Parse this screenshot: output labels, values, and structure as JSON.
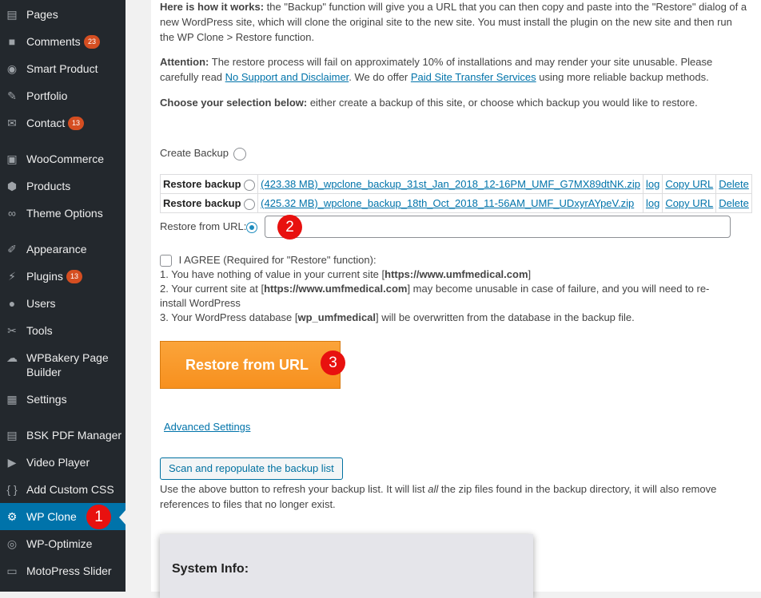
{
  "sidebar": {
    "items": [
      {
        "label": "Pages",
        "icon": "pages-icon",
        "glyph": "▤"
      },
      {
        "label": "Comments",
        "icon": "comments-icon",
        "glyph": "■",
        "count": "23"
      },
      {
        "label": "Smart Product",
        "icon": "eye-icon",
        "glyph": "◉"
      },
      {
        "label": "Portfolio",
        "icon": "pin-icon",
        "glyph": "✎"
      },
      {
        "label": "Contact",
        "icon": "mail-icon",
        "glyph": "✉",
        "count": "13"
      },
      {
        "label": "WooCommerce",
        "icon": "woocommerce-icon",
        "glyph": "▣"
      },
      {
        "label": "Products",
        "icon": "box-icon",
        "glyph": "⬢"
      },
      {
        "label": "Theme Options",
        "icon": "infinity-icon",
        "glyph": "∞"
      },
      {
        "label": "Appearance",
        "icon": "brush-icon",
        "glyph": "✐"
      },
      {
        "label": "Plugins",
        "icon": "plug-icon",
        "glyph": "⚡",
        "count": "13"
      },
      {
        "label": "Users",
        "icon": "user-icon",
        "glyph": "●"
      },
      {
        "label": "Tools",
        "icon": "wrench-icon",
        "glyph": "✂"
      },
      {
        "label": "WPBakery Page Builder",
        "icon": "cloud-icon",
        "glyph": "☁"
      },
      {
        "label": "Settings",
        "icon": "sliders-icon",
        "glyph": "▦"
      },
      {
        "label": "BSK PDF Manager",
        "icon": "document-icon",
        "glyph": "▤"
      },
      {
        "label": "Video Player",
        "icon": "video-icon",
        "glyph": "▶"
      },
      {
        "label": "Add Custom CSS",
        "icon": "braces-icon",
        "glyph": "{ }"
      },
      {
        "label": "WP Clone",
        "icon": "gear-icon",
        "glyph": "⚙"
      },
      {
        "label": "WP-Optimize",
        "icon": "optimize-icon",
        "glyph": "◎"
      },
      {
        "label": "MotoPress Slider",
        "icon": "slider-icon",
        "glyph": "▭"
      }
    ]
  },
  "intro": {
    "how_label": "Here is how it works:",
    "how_text": " the \"Backup\" function will give you a URL that you can then copy and paste into the \"Restore\" dialog of a new WordPress site, which will clone the original site to the new site. You must install the plugin on the new site and then run the WP Clone > Restore function.",
    "attention_label": "Attention:",
    "attention_text_1": " The restore process will fail on approximately 10% of installations and may render your site unusable. Please carefully read ",
    "attention_link_1": "No Support and Disclaimer",
    "attention_text_2": ". We do offer ",
    "attention_link_2": "Paid Site Transfer Services",
    "attention_text_3": " using more reliable backup methods.",
    "choose_label": "Choose your selection below:",
    "choose_text": " either create a backup of this site, or choose which backup you would like to restore."
  },
  "create_backup_label": "Create Backup",
  "backups": [
    {
      "label": "Restore backup",
      "file": "(423.38 MB)_wpclone_backup_31st_Jan_2018_12-16PM_UMF_G7MX89dtNK.zip",
      "log": "log",
      "copy": "Copy URL",
      "delete": "Delete"
    },
    {
      "label": "Restore backup",
      "file": "(425.32 MB)_wpclone_backup_18th_Oct_2018_11-56AM_UMF_UDxyrAYpeV.zip",
      "log": "log",
      "copy": "Copy URL",
      "delete": "Delete"
    }
  ],
  "restore_url_label": "Restore from URL:",
  "restore_url_value": "",
  "agree": {
    "label": "I AGREE (Required for \"Restore\" function):",
    "line1_a": "1. You have nothing of value in your current site [",
    "line1_b": "https://www.umfmedical.com",
    "line1_c": "]",
    "line2_a": "2. Your current site at [",
    "line2_b": "https://www.umfmedical.com",
    "line2_c": "] may become unusable in case of failure, and you will need to re-install WordPress",
    "line3_a": "3. Your WordPress database [",
    "line3_b": "wp_umfmedical",
    "line3_c": "] will be overwritten from the database in the backup file."
  },
  "restore_button": "Restore from URL",
  "advanced_settings": "Advanced Settings",
  "scan_button": "Scan and repopulate the backup list",
  "scan_help_1": "Use the above button to refresh your backup list. It will list ",
  "scan_help_em": "all",
  "scan_help_2": " the zip files found in the backup directory, it will also remove references to files that no longer exist.",
  "system_info_title": "System Info:",
  "badges": [
    "1",
    "2",
    "3"
  ],
  "colors": {
    "sidebar_bg": "#23282d",
    "active_bg": "#0073aa",
    "badge_red": "#e8110f",
    "button_orange": "#f7901e",
    "count_bg": "#d54e21"
  }
}
